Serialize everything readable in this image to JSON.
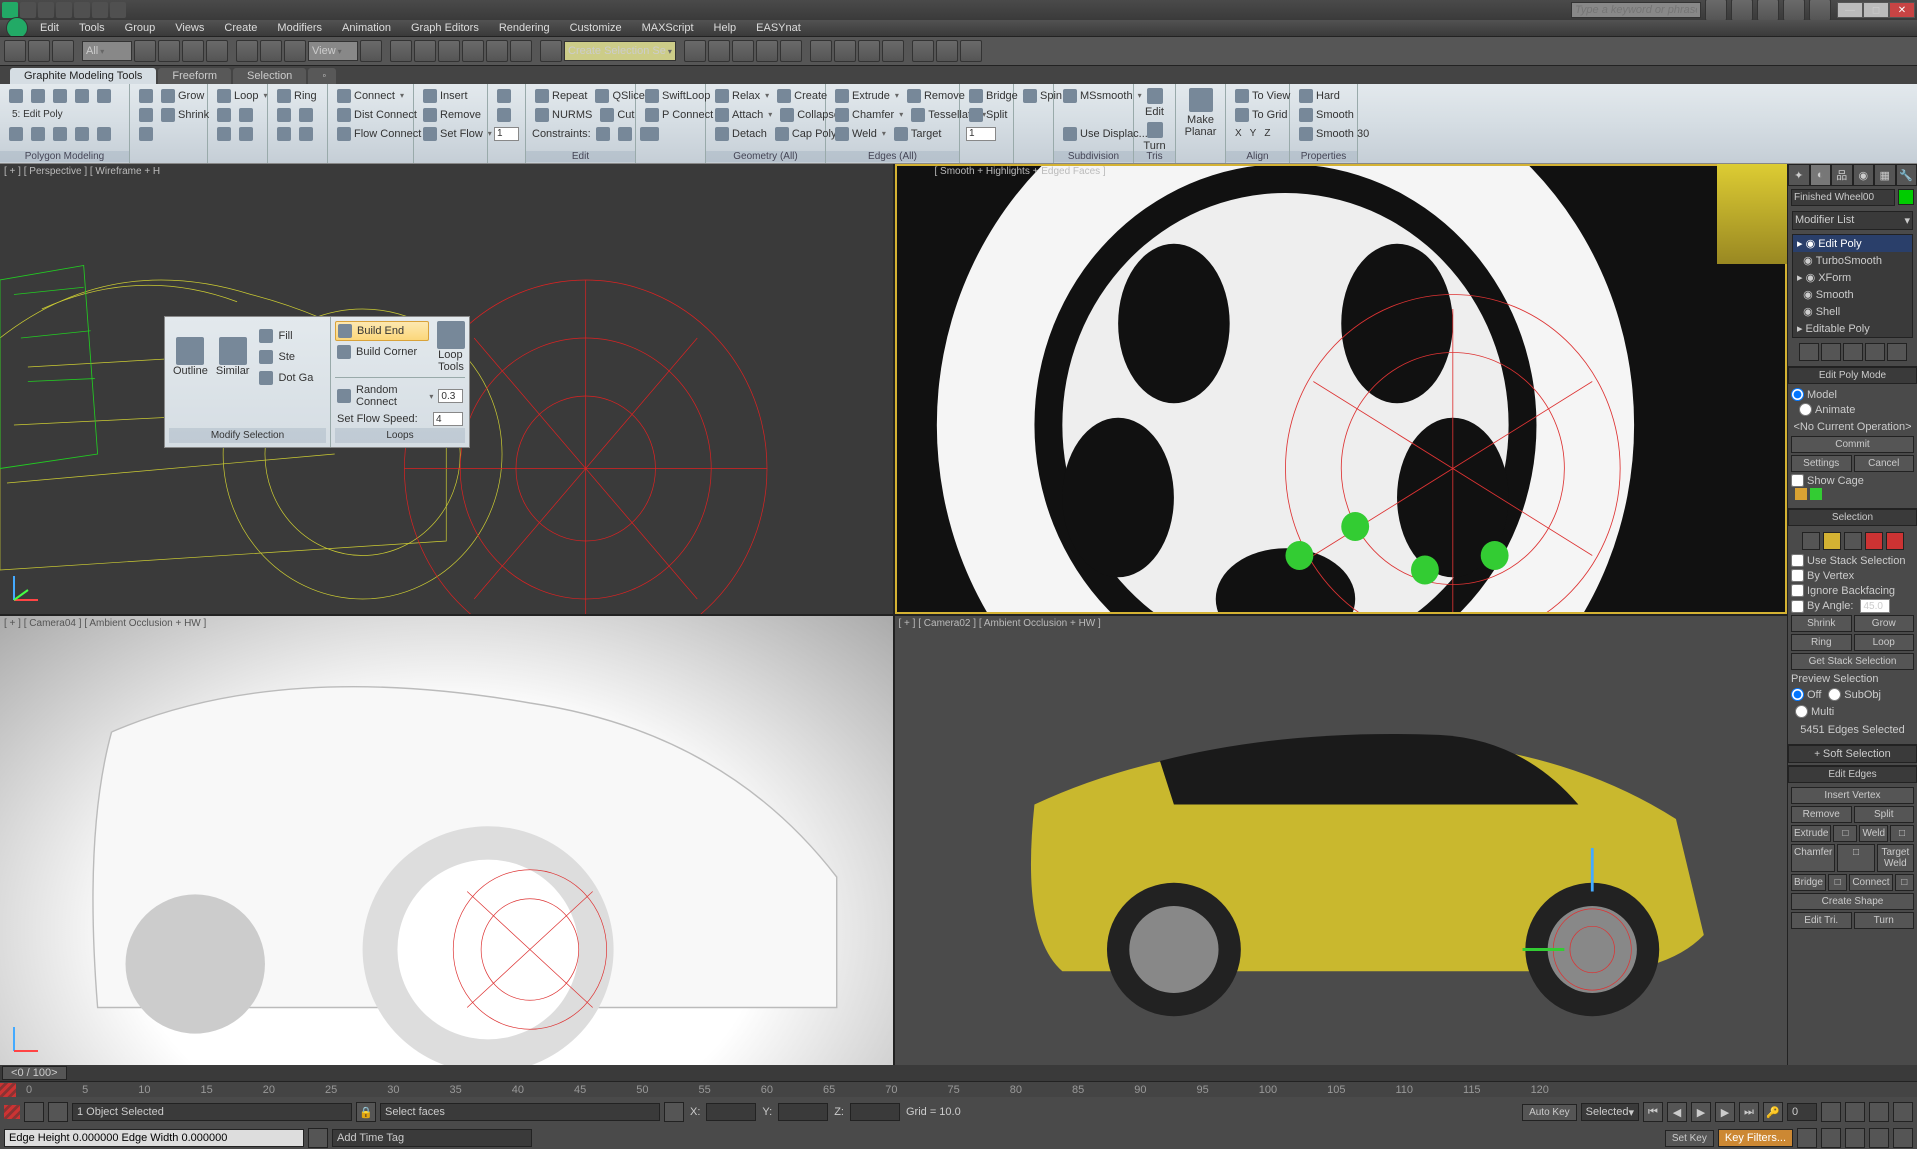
{
  "title_search_placeholder": "Type a keyword or phrase",
  "menubar": [
    "Edit",
    "Tools",
    "Group",
    "Views",
    "Create",
    "Modifiers",
    "Animation",
    "Graph Editors",
    "Rendering",
    "Customize",
    "MAXScript",
    "Help",
    "EASYnat"
  ],
  "toolbar_all": "All",
  "toolbar_view": "View",
  "toolbar_createsel": "Create Selection Se",
  "ribbon_tabs": {
    "active": "Graphite Modeling Tools",
    "others": [
      "Freeform",
      "Selection"
    ]
  },
  "polymode": "5: Edit Poly",
  "polymode_sub": "Polygon Modeling",
  "rib": {
    "shrink": "Shrink",
    "grow": "Grow",
    "loop": "Loop",
    "ring": "Ring",
    "connect": "Connect",
    "distconnect": "Dist Connect",
    "flowconnect": "Flow Connect",
    "insert": "Insert",
    "remove": "Remove",
    "setflow": "Set Flow",
    "one": "1",
    "repeat": "Repeat",
    "nurms": "NURMS",
    "constraints": "Constraints:",
    "qslice": "QSlice",
    "cut": "Cut",
    "swiftloop": "SwiftLoop",
    "pconnect": "P Connect",
    "relax": "Relax",
    "attach": "Attach",
    "detach": "Detach",
    "create": "Create",
    "collapse": "Collapse",
    "cappoly": "Cap Poly",
    "extrude": "Extrude",
    "chamfer": "Chamfer",
    "weld": "Weld",
    "remove2": "Remove",
    "tessellate": "Tessellate",
    "target": "Target",
    "bridge": "Bridge",
    "split": "Split",
    "spin": "Spin",
    "one2": "1",
    "mssmooth": "MSsmooth",
    "usedisplac": "Use Displac...",
    "edit": "Edit",
    "turn": "Turn",
    "makeplanar": "Make\nPlanar",
    "x": "X",
    "y": "Y",
    "z": "Z",
    "toview": "To View",
    "togrid": "To Grid",
    "align": "Align",
    "hard": "Hard",
    "smooth": "Smooth",
    "smooth30": "Smooth 30",
    "g_edit": "Edit",
    "g_edges": "Edges (All)",
    "g_geom": "Geometry (All)",
    "g_sub": "Subdivision",
    "g_tris": "Tris",
    "g_align": "Align",
    "g_prop": "Properties"
  },
  "popup": {
    "outline": "Outline",
    "similar": "Similar",
    "fill": "Fill",
    "step": "Ste",
    "dotga": "Dot Ga",
    "modifysel": "Modify Selection",
    "buildend": "Build End",
    "buildcorner": "Build Corner",
    "randomconnect": "Random Connect",
    "rc_val": "0.3",
    "setflowspeed": "Set Flow Speed:",
    "sf_val": "4",
    "loops": "Loops",
    "looptools": "Loop\nTools"
  },
  "viewports": {
    "vp1": "[ + ] [ Perspective ] [ Wireframe + H",
    "vp2": "[ Smooth + Highlights + Edged Faces ]",
    "vp3": "[ + ] [ Camera04 ] [ Ambient Occlusion + HW ]",
    "vp4": "[ + ] [ Camera02 ] [ Ambient Occlusion + HW ]"
  },
  "cmd": {
    "objname": "Finished Wheel00",
    "modlist": "Modifier List",
    "stack": [
      "Edit Poly",
      "TurboSmooth",
      "XForm",
      "Smooth",
      "Shell",
      "Editable Poly"
    ],
    "ro_editpoly": "Edit Poly Mode",
    "model": "Model",
    "animate": "Animate",
    "noop": "<No Current Operation>",
    "commit": "Commit",
    "settings": "Settings",
    "cancel": "Cancel",
    "showcage": "Show Cage",
    "ro_sel": "Selection",
    "usestack": "Use Stack Selection",
    "byvertex": "By Vertex",
    "ignoreback": "Ignore Backfacing",
    "byangle": "By Angle:",
    "angleval": "45.0",
    "shrink": "Shrink",
    "grow": "Grow",
    "ring": "Ring",
    "loop": "Loop",
    "getstack": "Get Stack Selection",
    "preview": "Preview Selection",
    "off": "Off",
    "subobj": "SubObj",
    "multi": "Multi",
    "selcount": "5451 Edges Selected",
    "ro_soft": "Soft Selection",
    "ro_editedges": "Edit Edges",
    "insvert": "Insert Vertex",
    "remove": "Remove",
    "split": "Split",
    "extrude": "Extrude",
    "weld": "Weld",
    "chamfer": "Chamfer",
    "tweld": "Target Weld",
    "bridge": "Bridge",
    "connect": "Connect",
    "cshape": "Create Shape",
    "edittri": "Edit Tri.",
    "turn": "Turn"
  },
  "time": {
    "slider": "0 / 100",
    "ticks": [
      "0",
      "5",
      "10",
      "15",
      "20",
      "25",
      "30",
      "35",
      "40",
      "45",
      "50",
      "55",
      "60",
      "65",
      "70",
      "75",
      "80",
      "85",
      "90",
      "95",
      "100",
      "105",
      "110",
      "115",
      "120"
    ]
  },
  "status": {
    "objsel": "1 Object Selected",
    "selfaces": "Select faces",
    "x": "X:",
    "y": "Y:",
    "z": "Z:",
    "grid": "Grid = 10.0",
    "autokey": "Auto Key",
    "selected": "Selected",
    "setkey": "Set Key",
    "keyfilters": "Key Filters...",
    "addtag": "Add Time Tag",
    "info": "Edge Height 0.000000 Edge Width 0.000000"
  }
}
